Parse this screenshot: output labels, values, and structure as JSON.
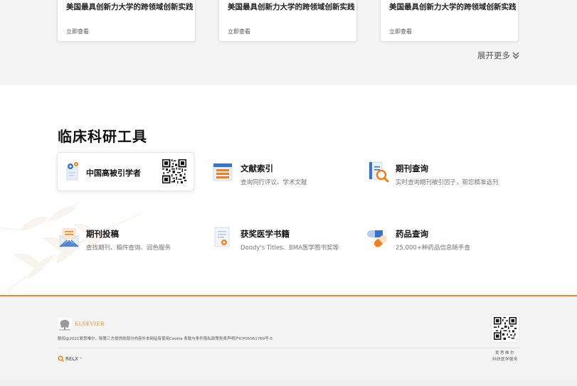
{
  "cards": [
    {
      "title": "美国最具创新力大学的跨领域创新实践",
      "link": "立即查看"
    },
    {
      "title": "美国最具创新力大学的跨领域创新实践",
      "link": "立即查看"
    },
    {
      "title": "美国最具创新力大学的跨领域创新实践",
      "link": "立即查看"
    }
  ],
  "more_label": "展开更多",
  "tools": {
    "title": "临床科研工具",
    "featured": {
      "name": "中国高被引学者",
      "icon": "scholar-gear-icon"
    },
    "items": [
      {
        "name": "文献索引",
        "desc": "查询同行评议、学术文献",
        "icon": "index-icon"
      },
      {
        "name": "期刊查询",
        "desc": "实时查询期刊被引因子，帮您精准选刊",
        "icon": "journal-search-icon"
      },
      {
        "name": "期刊投稿",
        "desc": "查找期刊、稿件查询、润色服务",
        "icon": "envelope-icon"
      },
      {
        "name": "获奖医学书籍",
        "desc": "Doody's Titles、BMA医学图书奖等",
        "icon": "certificate-icon"
      },
      {
        "name": "药品查询",
        "desc": "25,000+种药品信息随手查",
        "icon": "pill-icon"
      }
    ]
  },
  "footer": {
    "brand": "ELSEVIER",
    "copyright": "版权@2021爱思唯尔，除第三方提供的部分内容外本网站有使用Cookie  条款与条件隐私政策免责声明沪ICP05061760号-5",
    "relx": "RELX",
    "relx_tm": "™",
    "qr_caption_line1": "爱思唯尔",
    "qr_caption_line2": "科研医学服务"
  },
  "colors": {
    "accent": "#e8882c",
    "brand_orange": "#f07f1c",
    "blue": "#3b73c8"
  }
}
